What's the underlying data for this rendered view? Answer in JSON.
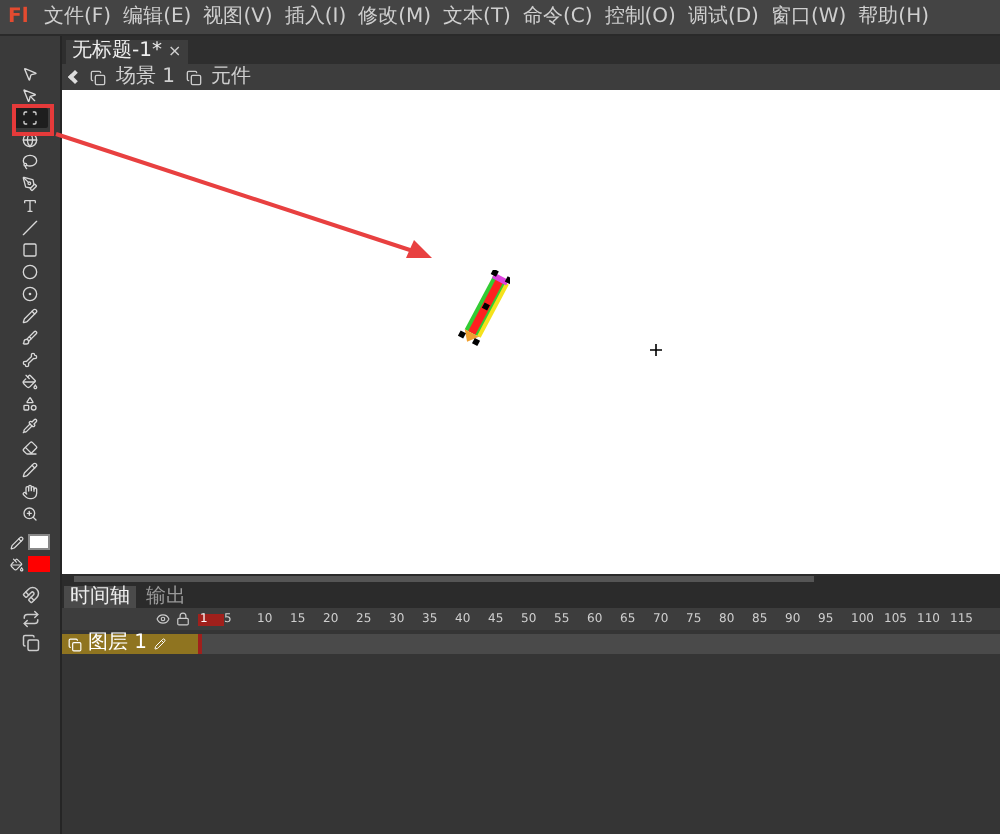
{
  "app": {
    "logo": "Fl"
  },
  "menu": [
    "文件(F)",
    "编辑(E)",
    "视图(V)",
    "插入(I)",
    "修改(M)",
    "文本(T)",
    "命令(C)",
    "控制(O)",
    "调试(D)",
    "窗口(W)",
    "帮助(H)"
  ],
  "document_tab": {
    "title": "无标题-1*",
    "close": "×"
  },
  "breadcrumb": [
    "场景 1",
    "元件"
  ],
  "tools": [
    {
      "selected": false
    },
    {
      "selected": false
    },
    {
      "selected": true
    },
    {
      "selected": false
    },
    {
      "selected": false
    },
    {
      "selected": false
    },
    {
      "selected": false
    },
    {
      "selected": false
    },
    {
      "selected": false
    },
    {
      "selected": false
    },
    {
      "selected": false
    },
    {
      "selected": false
    },
    {
      "selected": false
    },
    {
      "selected": false
    },
    {
      "selected": false
    },
    {
      "selected": false
    },
    {
      "selected": false
    },
    {
      "selected": false
    },
    {
      "selected": false
    },
    {
      "selected": false
    },
    {
      "selected": false
    }
  ],
  "fill_color": {
    "color": "#ff0000"
  },
  "timeline": {
    "tabs": [
      {
        "label": "时间轴",
        "selected": true
      },
      {
        "label": "输出",
        "selected": false
      }
    ],
    "frame_numbers": [
      "1",
      "5",
      "10",
      "15",
      "20",
      "25",
      "30",
      "35",
      "40",
      "45",
      "50",
      "55",
      "60",
      "65",
      "70",
      "75",
      "80",
      "85",
      "90",
      "95",
      "100",
      "105",
      "110",
      "115"
    ],
    "layers": [
      {
        "name": "图层 1",
        "selected": true
      }
    ]
  }
}
